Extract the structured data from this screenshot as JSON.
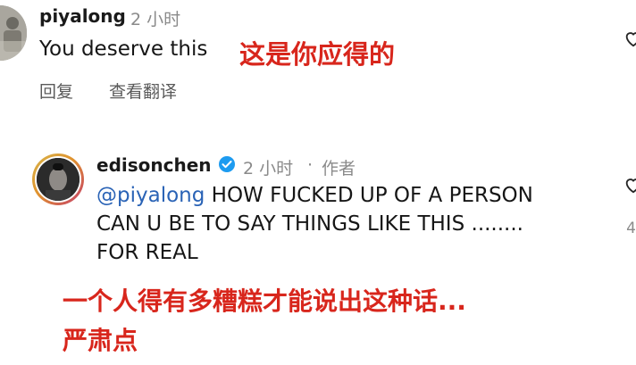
{
  "comment1": {
    "username": "piyalong",
    "time": "2 小时",
    "text": "You deserve this",
    "translation": "这是你应得的",
    "reply_label": "回复",
    "translate_label": "查看翻译"
  },
  "comment2": {
    "username": "edisonchen",
    "time": "2 小时",
    "separator": "·",
    "author_tag": "作者",
    "mention": "@piyalong",
    "line1": " HOW FUCKED UP OF A PERSON",
    "line2": "CAN U BE TO SAY THINGS LIKE THIS ........",
    "line3": "FOR REAL",
    "translation_line1": "一个人得有多糟糕才能说出这种话...",
    "translation_line2": "严肃点",
    "like_count_partial": "4"
  },
  "colors": {
    "translation_red": "#d8261c",
    "mention_blue": "#2a63b6",
    "verified_blue": "#1d9bf0",
    "meta_gray": "#8a8a8a"
  },
  "icons": [
    "heart-icon",
    "verified-badge-icon"
  ]
}
